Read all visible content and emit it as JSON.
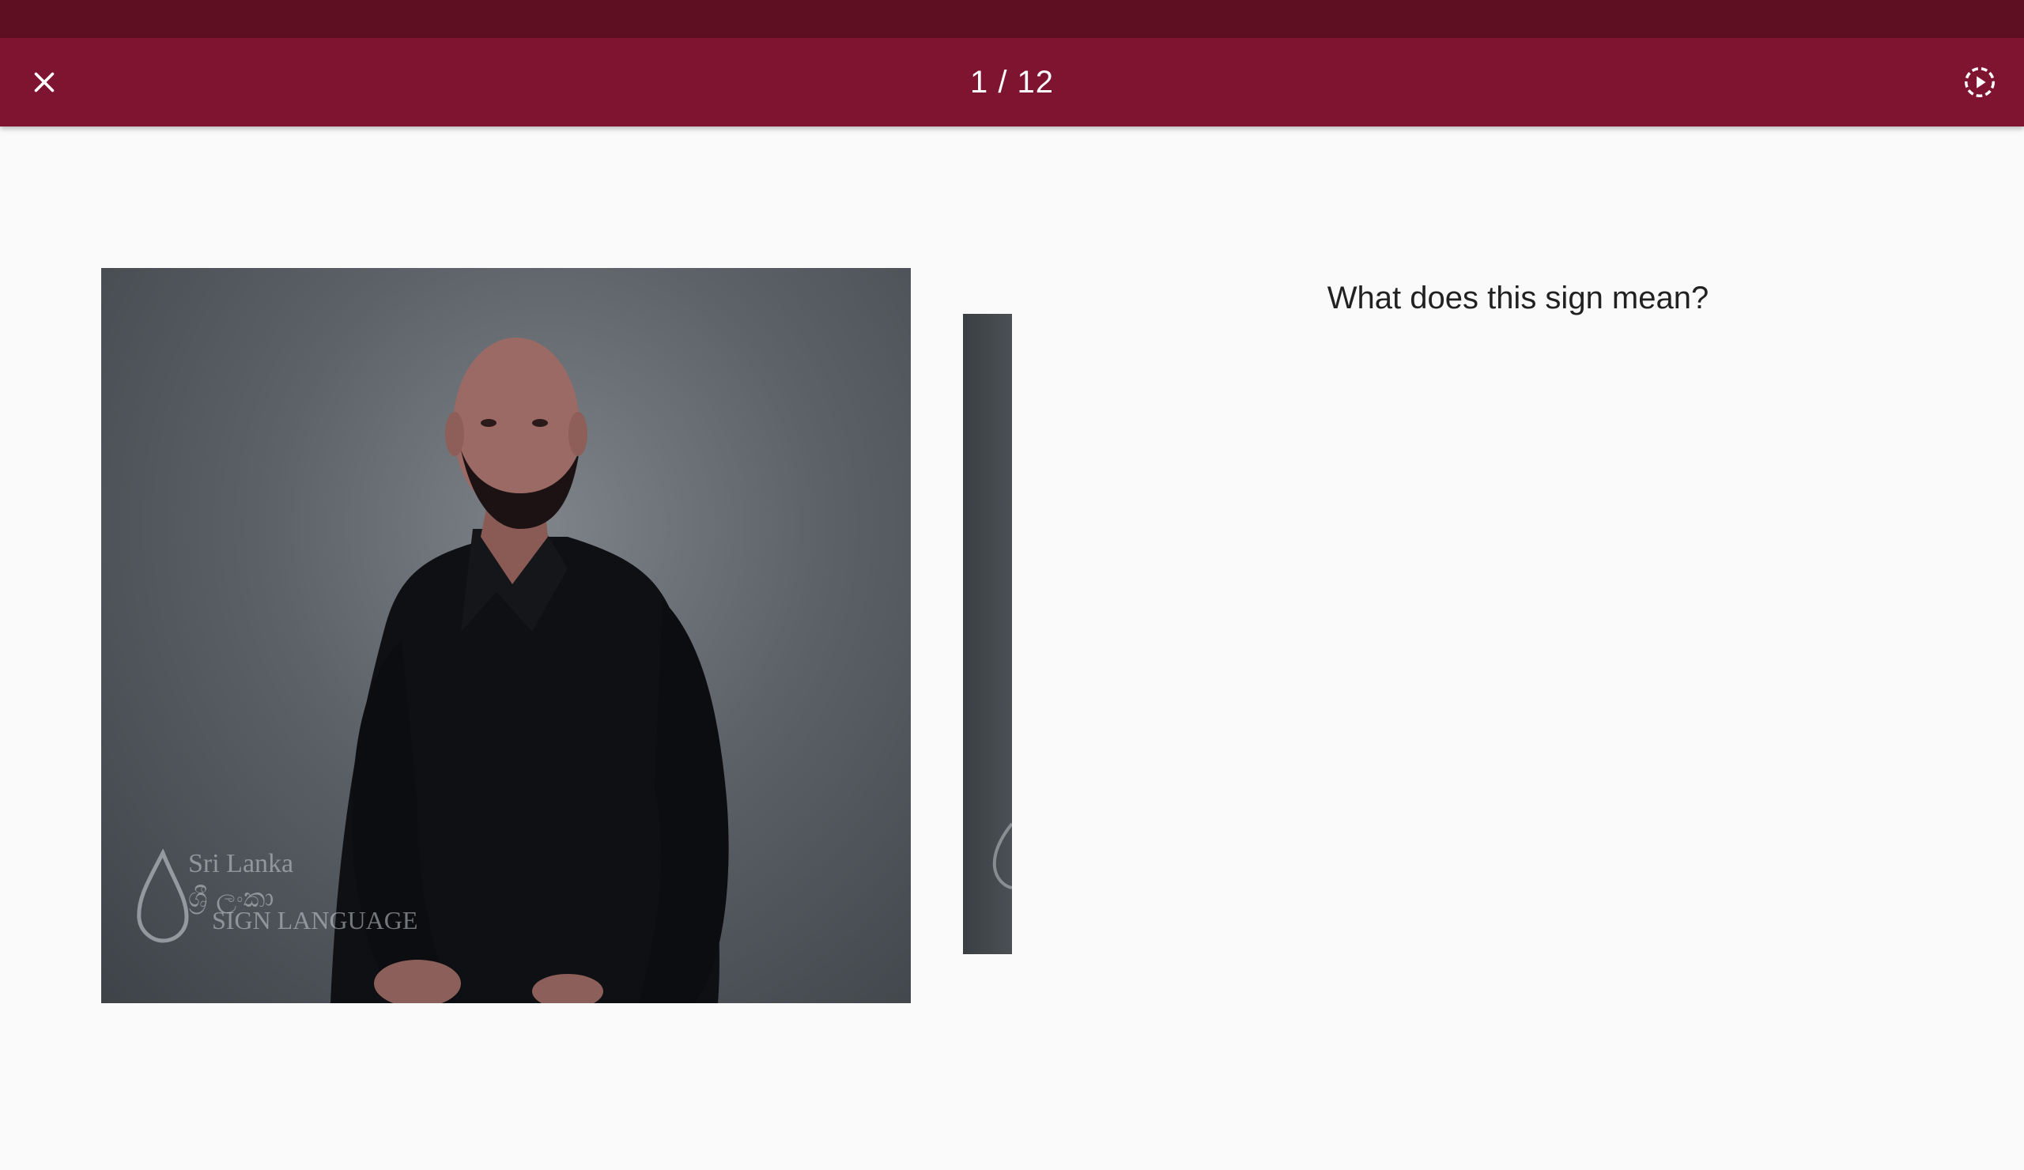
{
  "header": {
    "counter": "1 / 12",
    "close_icon": "close-icon",
    "autoplay_icon": "autoplay-icon"
  },
  "video": {
    "watermark_line1": "Sri Lanka",
    "watermark_line2": "ශ්‍රී ලංකා",
    "watermark_line3": "SIGN LANGUAGE"
  },
  "question": {
    "text": "What does this sign mean?"
  },
  "colors": {
    "status_bar": "#5e0f22",
    "app_bar": "#7f1431",
    "background": "#fafafa"
  }
}
